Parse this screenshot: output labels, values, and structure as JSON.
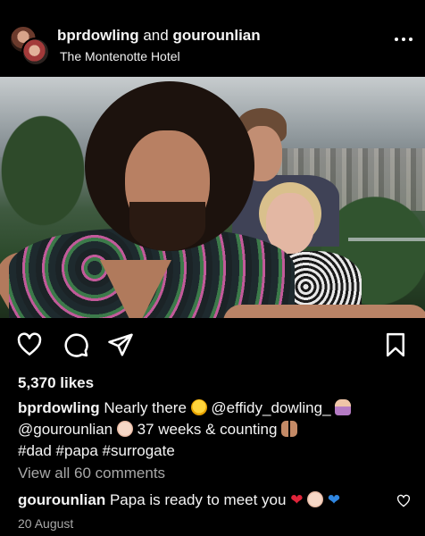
{
  "post": {
    "user1": "bprdowling",
    "joiner": "and",
    "user2": "gourounlian",
    "location": "The Montenotte Hotel",
    "likes": "5,370 likes",
    "caption_user": "bprdowling",
    "caption_part1": "Nearly there",
    "mention1": "@effidy_dowling_",
    "mention2": "@gourounlian",
    "caption_part2": "37 weeks & counting",
    "hashtags": "#dad #papa #surrogate",
    "view_all": "View all 60 comments",
    "comment_user": "gourounlian",
    "comment_text": "Papa is ready to meet you",
    "date": "20 August"
  },
  "icons": {
    "like": "heart-icon",
    "comment": "comment-icon",
    "share": "send-icon",
    "save": "bookmark-icon",
    "more": "more-icon"
  },
  "colors": {
    "background": "#000000",
    "text": "#f5f5f5",
    "muted": "#a8a8a8"
  }
}
